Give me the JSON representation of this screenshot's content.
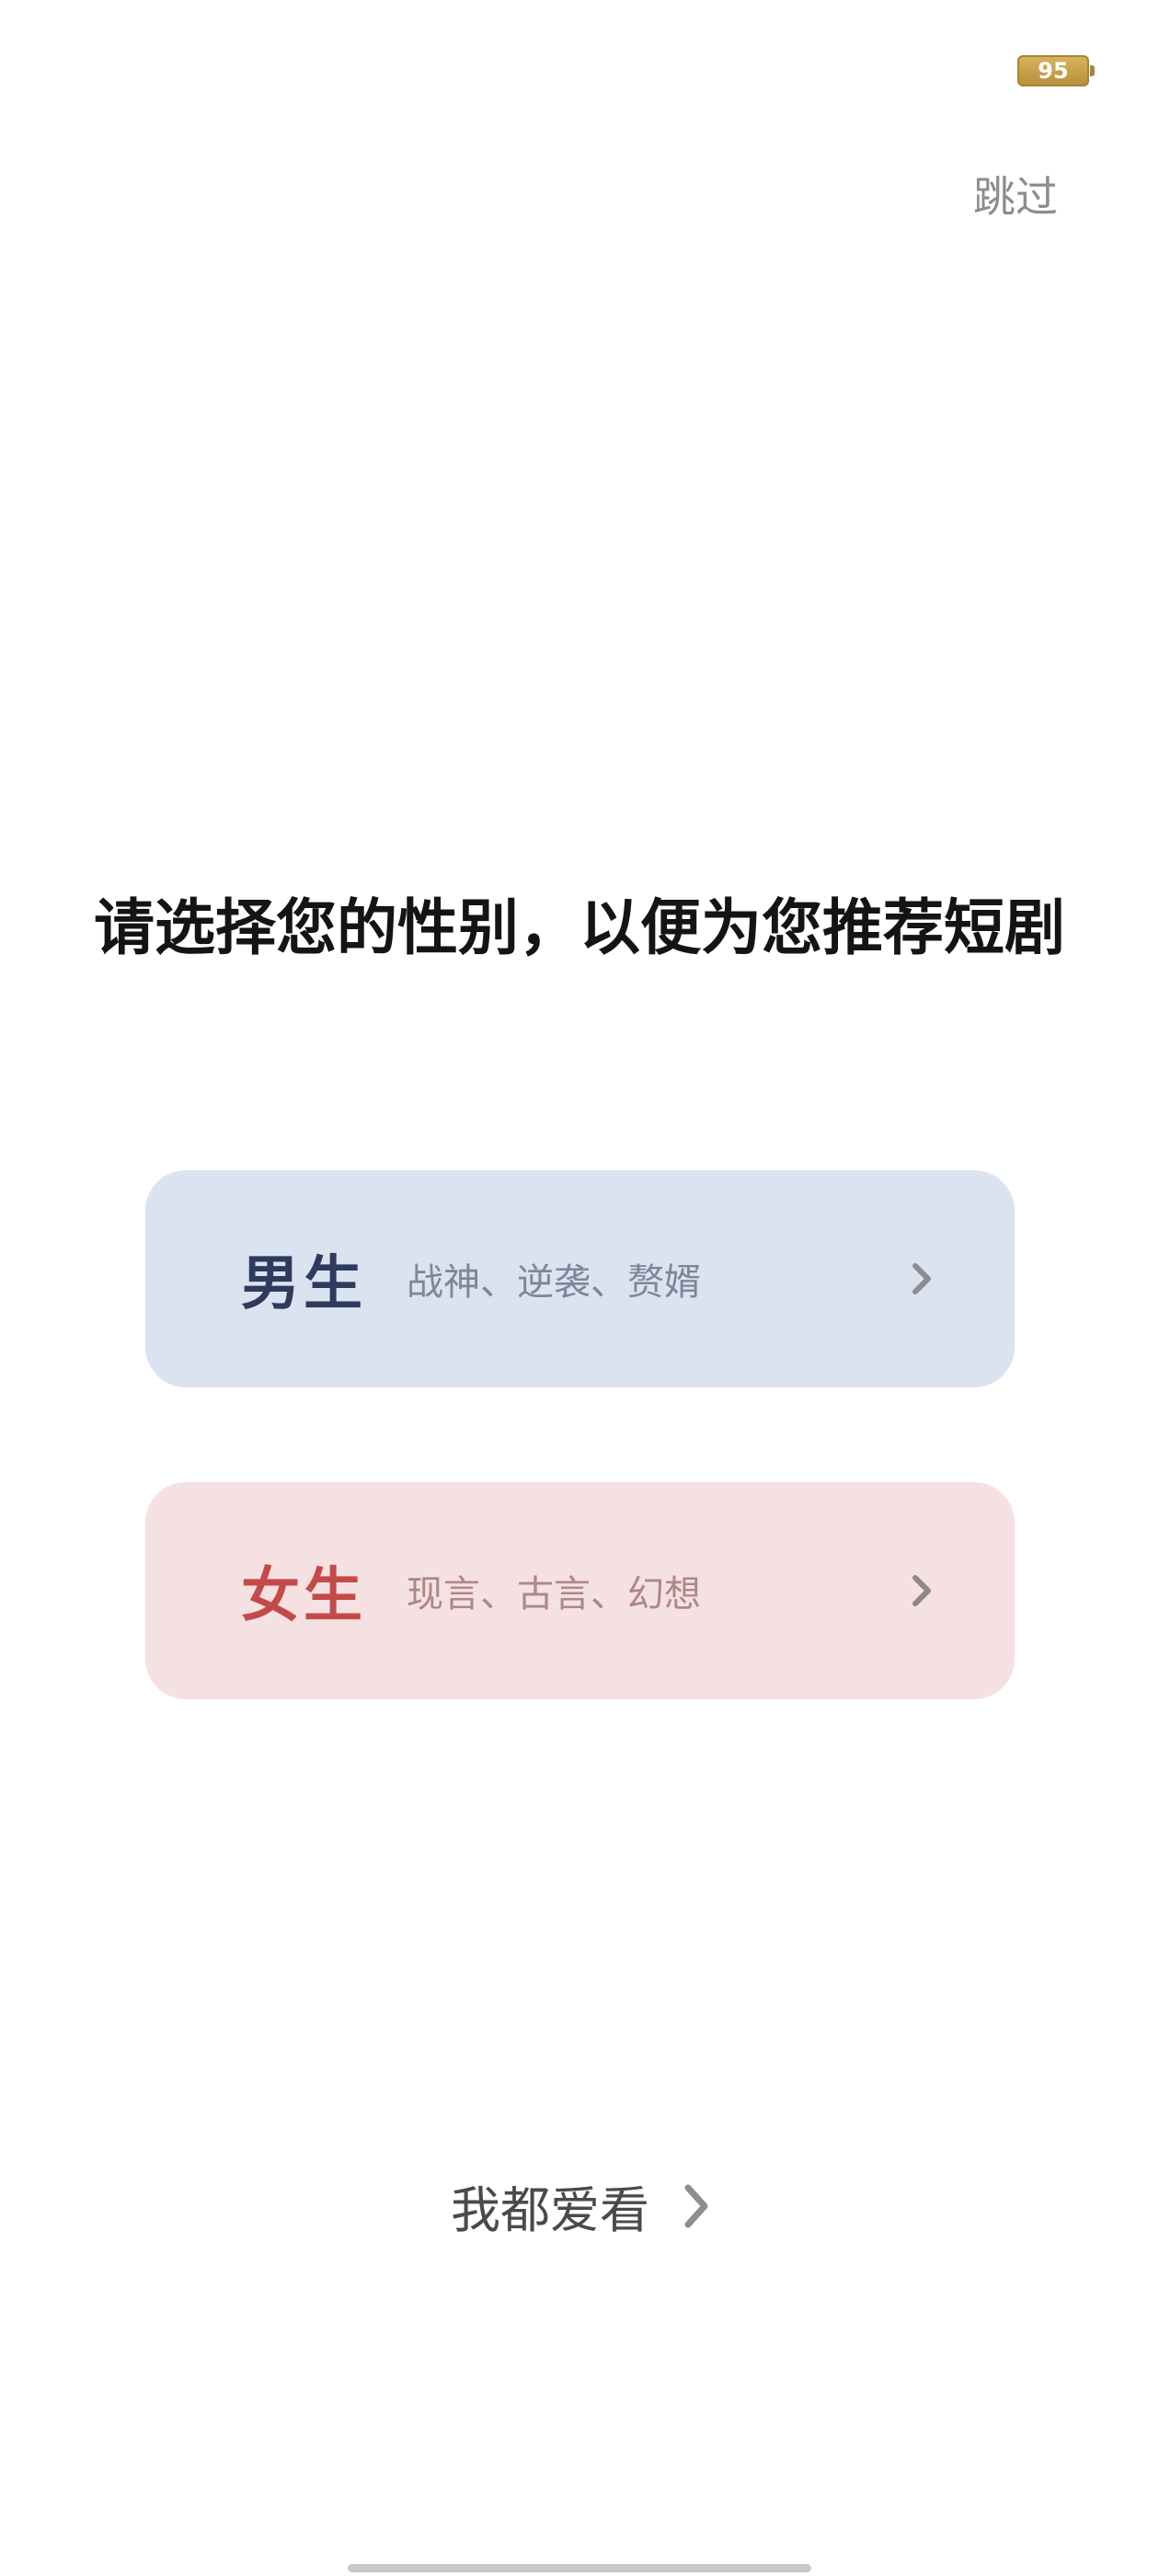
{
  "status_bar": {
    "battery_level": "95",
    "battery_color": "#c9a24a"
  },
  "header": {
    "skip_label": "跳过"
  },
  "main": {
    "title": "请选择您的性别，以便为您推荐短剧",
    "options": [
      {
        "label": "男生",
        "description": "战神、逆袭、赘婿",
        "background_color": "#dae3ef",
        "label_color": "#2f3b5c",
        "icon": "chevron-right-icon"
      },
      {
        "label": "女生",
        "description": "现言、古言、幻想",
        "background_color": "#f5e1e2",
        "label_color": "#c44a4a",
        "icon": "chevron-right-icon"
      }
    ],
    "both_label": "我都爱看",
    "both_icon": "chevron-right-icon"
  }
}
